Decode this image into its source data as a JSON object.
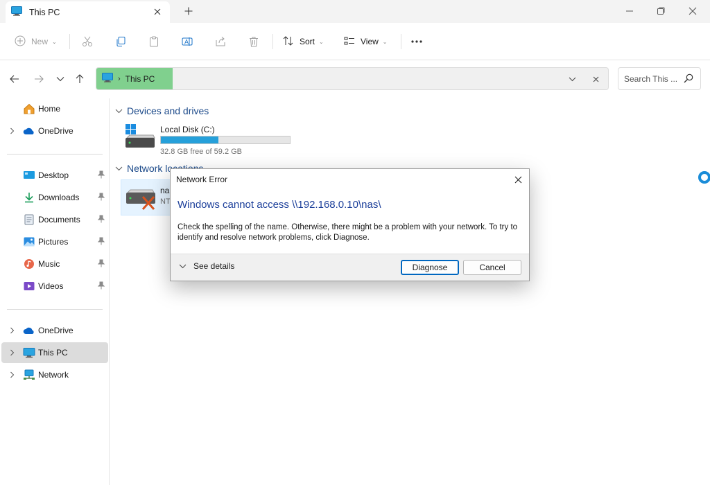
{
  "window": {
    "tab_title": "This PC",
    "tab_icon": "this-pc-icon",
    "controls": [
      "minimize-icon",
      "maximize-icon",
      "close-icon"
    ]
  },
  "toolbar": {
    "new_label": "New",
    "sort_label": "Sort",
    "view_label": "View",
    "icons": [
      "new-icon",
      "cut-icon",
      "copy-icon",
      "paste-icon",
      "rename-icon",
      "share-icon",
      "delete-icon",
      "sort-icon",
      "view-icon",
      "more-icon"
    ]
  },
  "address": {
    "location": "This PC",
    "search_placeholder": "Search This ..."
  },
  "sidebar": {
    "items": [
      {
        "label": "Home",
        "icon": "home-icon"
      },
      {
        "label": "OneDrive",
        "icon": "onedrive-icon"
      },
      {
        "label": "Desktop",
        "icon": "desktop-icon"
      },
      {
        "label": "Downloads",
        "icon": "downloads-icon"
      },
      {
        "label": "Documents",
        "icon": "documents-icon"
      },
      {
        "label": "Pictures",
        "icon": "pictures-icon"
      },
      {
        "label": "Music",
        "icon": "music-icon"
      },
      {
        "label": "Videos",
        "icon": "videos-icon"
      },
      {
        "label": "OneDrive",
        "icon": "onedrive-icon"
      },
      {
        "label": "This PC",
        "icon": "this-pc-icon",
        "selected": true
      },
      {
        "label": "Network",
        "icon": "network-icon"
      }
    ]
  },
  "content": {
    "devices_header": "Devices and drives",
    "network_header": "Network locations",
    "drive": {
      "name": "Local Disk (C:)",
      "free_text": "32.8 GB free of 59.2 GB",
      "used_fraction": 0.446
    },
    "network_location": {
      "name": "na",
      "sub": "NT"
    }
  },
  "dialog": {
    "title": "Network Error",
    "heading": "Windows cannot access \\\\192.168.0.10\\nas\\",
    "message": "Check the spelling of the name. Otherwise, there might be a problem with your network. To try to identify and resolve network problems, click Diagnose.",
    "see_details": "See details",
    "diagnose_label": "Diagnose",
    "cancel_label": "Cancel"
  },
  "colors": {
    "accent": "#0067c0",
    "address_highlight": "#80d08e",
    "group_header": "#1c4a8a",
    "dialog_heading": "#1c3f9a",
    "drive_bar": "#26a0da"
  }
}
